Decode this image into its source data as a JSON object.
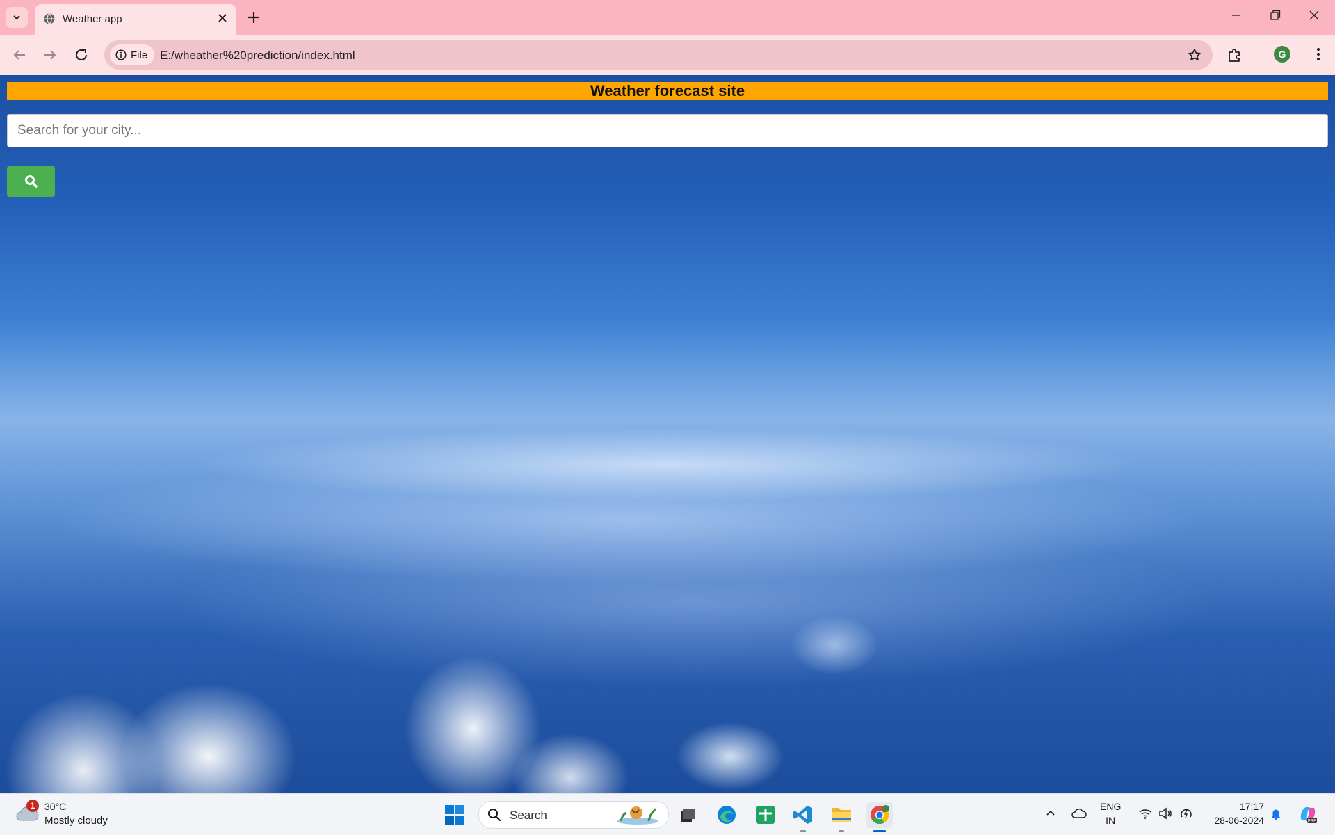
{
  "browser": {
    "tab": {
      "title": "Weather app"
    },
    "address": {
      "scheme_chip": "File",
      "url": "E:/wheather%20prediction/index.html"
    },
    "profile_initial": "G"
  },
  "page": {
    "header_title": "Weather forecast site",
    "search_placeholder": "Search for your city...",
    "search_button_icon": "search-icon",
    "header_color": "#ffa500",
    "button_color": "#4caf50"
  },
  "taskbar": {
    "weather": {
      "badge": "1",
      "temperature": "30°C",
      "condition": "Mostly cloudy"
    },
    "search_label": "Search",
    "apps": [
      "start",
      "search",
      "task-view",
      "edge",
      "sheets",
      "vscode",
      "file-explorer",
      "chrome"
    ],
    "tray": {
      "lang_top": "ENG",
      "lang_bottom": "IN",
      "time": "17:17",
      "date": "28-06-2024"
    }
  }
}
